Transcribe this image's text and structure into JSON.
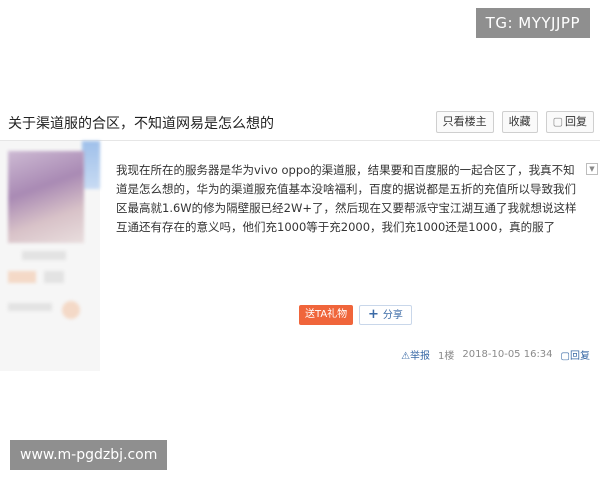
{
  "overlay": {
    "tg_label": "TG: MYYJJPP",
    "site_watermark": "www.m-pgdzbj.com"
  },
  "post": {
    "title": "关于渠道服的合区，不知道网易是怎么想的",
    "actions": {
      "only_op": "只看楼主",
      "favorite": "收藏",
      "reply": "回复"
    },
    "body": "我现在所在的服务器是华为vivo oppo的渠道服，结果要和百度服的一起合区了，我真不知道是怎么想的，华为的渠道服充值基本没啥福利，百度的据说都是五折的充值所以导致我们区最高就1.6W的修为隔壁服已经2W+了，然后现在又要帮派守宝江湖互通了我就想说这样互通还有存在的意义吗，他们充1000等于充2000，我们充1000还是1000，真的服了",
    "gift_label": "送TA礼物",
    "share_label": "分享",
    "meta": {
      "report": "举报",
      "floor": "1楼",
      "datetime": "2018-10-05 16:34",
      "reply": "回复"
    }
  },
  "colors": {
    "accent_orange": "#f0653b",
    "link_blue": "#3a6aa6"
  }
}
